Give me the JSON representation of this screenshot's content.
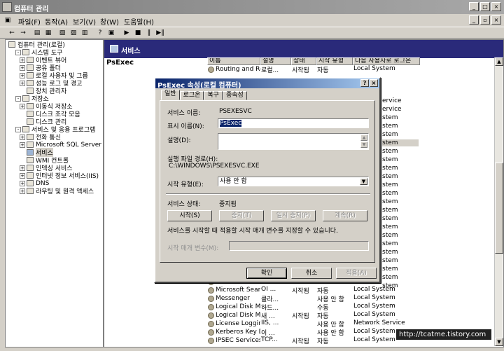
{
  "window": {
    "title": "컴퓨터 관리"
  },
  "menu": [
    "파일(F)",
    "동작(A)",
    "보기(V)",
    "창(W)",
    "도움말(H)"
  ],
  "tree": [
    {
      "label": "컴퓨터 관리(로컬)",
      "level": 0,
      "expander": ""
    },
    {
      "label": "시스템 도구",
      "level": 1,
      "expander": "-"
    },
    {
      "label": "이벤트 뷰어",
      "level": 2,
      "expander": "+"
    },
    {
      "label": "공유 폴더",
      "level": 2,
      "expander": "+"
    },
    {
      "label": "로컬 사용자 및 그룹",
      "level": 2,
      "expander": "+"
    },
    {
      "label": "성능 로그 및 경고",
      "level": 2,
      "expander": "+"
    },
    {
      "label": "장치 관리자",
      "level": 2,
      "expander": ""
    },
    {
      "label": "저장소",
      "level": 1,
      "expander": "-"
    },
    {
      "label": "이동식 저장소",
      "level": 2,
      "expander": "+"
    },
    {
      "label": "디스크 조각 모음",
      "level": 2,
      "expander": ""
    },
    {
      "label": "디스크 관리",
      "level": 2,
      "expander": ""
    },
    {
      "label": "서비스 및 응용 프로그램",
      "level": 1,
      "expander": "-"
    },
    {
      "label": "전화 통신",
      "level": 2,
      "expander": "+"
    },
    {
      "label": "Microsoft SQL Server",
      "level": 2,
      "expander": "+"
    },
    {
      "label": "서비스",
      "level": 2,
      "expander": "",
      "selected": true
    },
    {
      "label": "WMI 컨트롤",
      "level": 2,
      "expander": ""
    },
    {
      "label": "인덱싱 서비스",
      "level": 2,
      "expander": "+"
    },
    {
      "label": "인터넷 정보 서비스(IIS)",
      "level": 2,
      "expander": "+"
    },
    {
      "label": "DNS",
      "level": 2,
      "expander": "+"
    },
    {
      "label": "라우팅 및 원격 액세스",
      "level": 2,
      "expander": "+"
    }
  ],
  "right_header": "서비스",
  "selected_service": "PsExec",
  "list_headers": [
    "이름",
    "설명",
    "상태",
    "시작 유형",
    "다음 사용자로 로그온"
  ],
  "services_top": [
    {
      "name": "Routing and Re...",
      "desc": "로컬...",
      "status": "시작됨",
      "startup": "자동",
      "logon": "Local System"
    }
  ],
  "logon_peek": [
    "ervice",
    "ervice",
    "stem",
    "stem",
    "stem",
    "stem",
    "stem",
    "stem",
    "stem",
    "stem",
    "stem",
    "stem",
    "stem",
    "stem",
    "stem",
    "stem",
    "stem",
    "stem",
    "stem",
    "stem",
    "stem",
    "stem",
    "stem"
  ],
  "services_bottom": [
    {
      "name": "Microsoft Softwa...",
      "desc": "",
      "status": "",
      "startup": "",
      "logon": ""
    },
    {
      "name": "Microsoft Search",
      "desc": "OI ...",
      "status": "시작됨",
      "startup": "자동",
      "logon": "Local System"
    },
    {
      "name": "Messenger",
      "desc": "클라...",
      "status": "",
      "startup": "사용 안 함",
      "logon": "Local System"
    },
    {
      "name": "Logical Disk Ma...",
      "desc": "하드...",
      "status": "",
      "startup": "수동",
      "logon": "Local System"
    },
    {
      "name": "Logical Disk Ma...",
      "desc": "새 ...",
      "status": "시작됨",
      "startup": "자동",
      "logon": "Local System"
    },
    {
      "name": "License Logging",
      "desc": "IIS, ...",
      "status": "",
      "startup": "사용 안 함",
      "logon": "Network Service"
    },
    {
      "name": "Kerberos Key Di...",
      "desc": "이 ...",
      "status": "",
      "startup": "사용 안 함",
      "logon": "Local System"
    },
    {
      "name": "IPSEC Services",
      "desc": "TCP...",
      "status": "시작됨",
      "startup": "자동",
      "logon": "Local System"
    }
  ],
  "dialog": {
    "title": "PsExec 속성(로컬 컴퓨터)",
    "tabs": [
      "일반",
      "로그온",
      "복구",
      "종속성"
    ],
    "service_name_label": "서비스 이름:",
    "service_name": "PSEXESVC",
    "display_name_label": "표시 이름(N):",
    "display_name": "PsExec",
    "description_label": "설명(D):",
    "path_label": "실행 파일 경로(H):",
    "path": "C:\\WINDOWS\\PSEXESVC.EXE",
    "startup_label": "시작 유형(E):",
    "startup_value": "사용 안 함",
    "status_label": "서비스 상태:",
    "status_value": "중지됨",
    "btn_start": "시작(S)",
    "btn_stop": "중지(T)",
    "btn_pause": "일시 중지(P)",
    "btn_resume": "계속(R)",
    "hint": "서비스를 시작할 때 적용할 시작 매개 변수를 지정할 수 있습니다.",
    "params_label": "시작 매개 변수(M):",
    "ok": "확인",
    "cancel": "취소",
    "apply": "적용(A)"
  },
  "watermark": "http://tcatme.tistory.com"
}
